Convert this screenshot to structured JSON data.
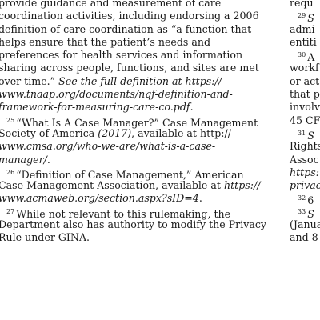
{
  "left_column": {
    "lines": [
      {
        "text": "provide guidance and measurement of care"
      },
      {
        "text": "coordination activities, including endorsing a 2006"
      },
      {
        "text": "definition of care coordination as “a function that"
      },
      {
        "text": "helps ensure that the patient’s needs and"
      },
      {
        "text": "preferences for health services and information"
      },
      {
        "text": "sharing across people, functions, and sites are met"
      },
      {
        "text": "over time.” ",
        "italic": "See the full definition at https://"
      },
      {
        "italic": "www.tnaap.org/documents/nqf-definition-and-"
      },
      {
        "italic": "framework-for-measuring-care-co.pdf",
        "text_after": "."
      },
      {
        "indent": true,
        "num": "25",
        "text": "“What Is A Case Manager?” Case Management"
      },
      {
        "text": "Society of America ",
        "italic": "(2017)",
        "text_after": ", available at http://"
      },
      {
        "italic": "www.cmsa.org/who-we-are/what-is-a-case-"
      },
      {
        "italic": "manager/",
        "text_after": "."
      },
      {
        "indent": true,
        "num": "26",
        "text": "“Definition of Case Management,” American"
      },
      {
        "text": "Case Management Association, available at ",
        "italic": "https://"
      },
      {
        "italic": "www.acmaweb.org/section.aspx?sID=4",
        "text_after": "."
      },
      {
        "indent": true,
        "num": "27",
        "text": "While not relevant to this rulemaking, the"
      },
      {
        "text": "Department also has authority to modify the Privacy"
      },
      {
        "text": "Rule under GINA."
      }
    ]
  },
  "right_column": {
    "lines": [
      {
        "text": "requ"
      },
      {
        "indent": true,
        "num": "29",
        "italic": "S"
      },
      {
        "text": "admi"
      },
      {
        "text": "entiti"
      },
      {
        "indent": true,
        "num": "30",
        "text": "A"
      },
      {
        "text": "workf"
      },
      {
        "text": "or act"
      },
      {
        "text": "that p"
      },
      {
        "text": "involv"
      },
      {
        "text": "45 CF"
      },
      {
        "indent": true,
        "num": "31",
        "italic": "S"
      },
      {
        "text": "Rights"
      },
      {
        "text": "Assoc"
      },
      {
        "italic": "https:"
      },
      {
        "italic": "privac"
      },
      {
        "indent": true,
        "num": "32",
        "text": "6"
      },
      {
        "indent": true,
        "num": "33",
        "italic": "S"
      },
      {
        "text": "(Janua"
      },
      {
        "text": "and 8"
      }
    ]
  }
}
